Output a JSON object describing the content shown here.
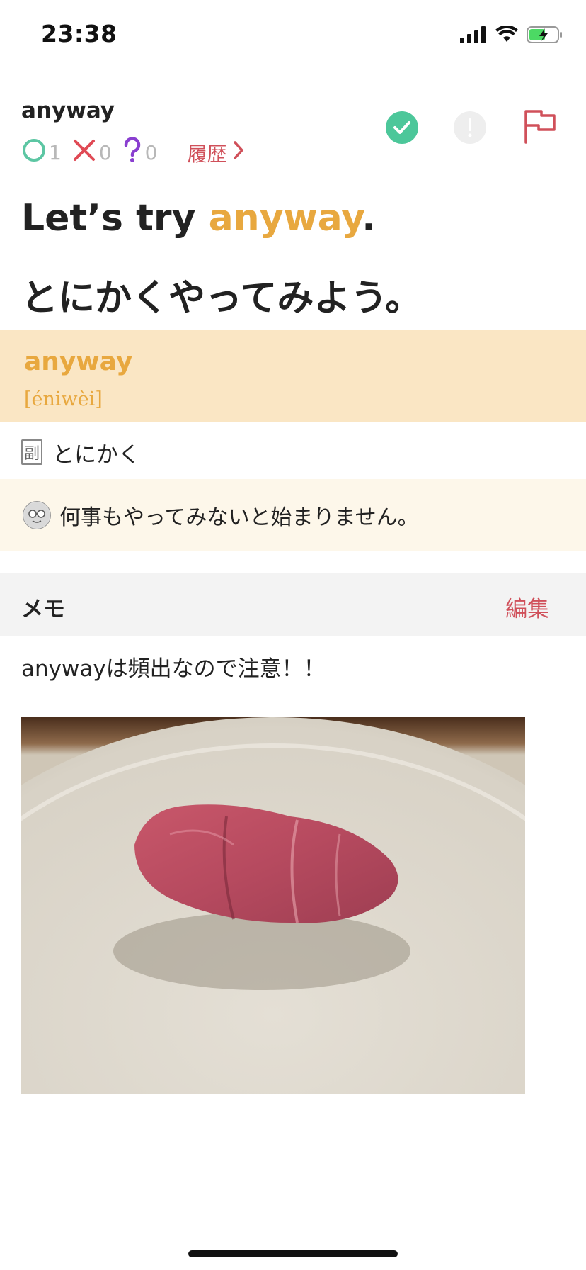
{
  "status_bar": {
    "time": "23:38",
    "icons": [
      "signal-icon",
      "wifi-icon",
      "battery-charging-icon"
    ]
  },
  "word": {
    "title": "anyway",
    "stats": {
      "correct_count": "1",
      "wrong_count": "0",
      "unsure_count": "0"
    },
    "history_label": "履歴",
    "actions": [
      "check-circle-icon",
      "exclamation-circle-icon",
      "flag-icon"
    ]
  },
  "example": {
    "en_prefix": "Let’s try ",
    "en_highlight": "anyway",
    "en_suffix": ".",
    "ja": "とにかくやってみよう。"
  },
  "definition": {
    "word": "anyway",
    "pronunciation": "[éniwèi]"
  },
  "part_of_speech": {
    "badge": "副",
    "meaning": "とにかく"
  },
  "explanation": {
    "text": "何事もやってみないと始まりません。"
  },
  "memo": {
    "title": "メモ",
    "edit_label": "編集",
    "text": "anywayは頻出なので注意！！"
  },
  "colors": {
    "accent_orange": "#e8a83f",
    "accent_red": "#d0505a",
    "check_green": "#4cc79a",
    "correct_green": "#5cc6a3",
    "wrong_red": "#e04a55",
    "unsure_purple": "#8a3fd0",
    "definition_bg": "#fae6c4",
    "explanation_bg": "#fdf7ea",
    "memo_header_bg": "#f3f3f3"
  }
}
